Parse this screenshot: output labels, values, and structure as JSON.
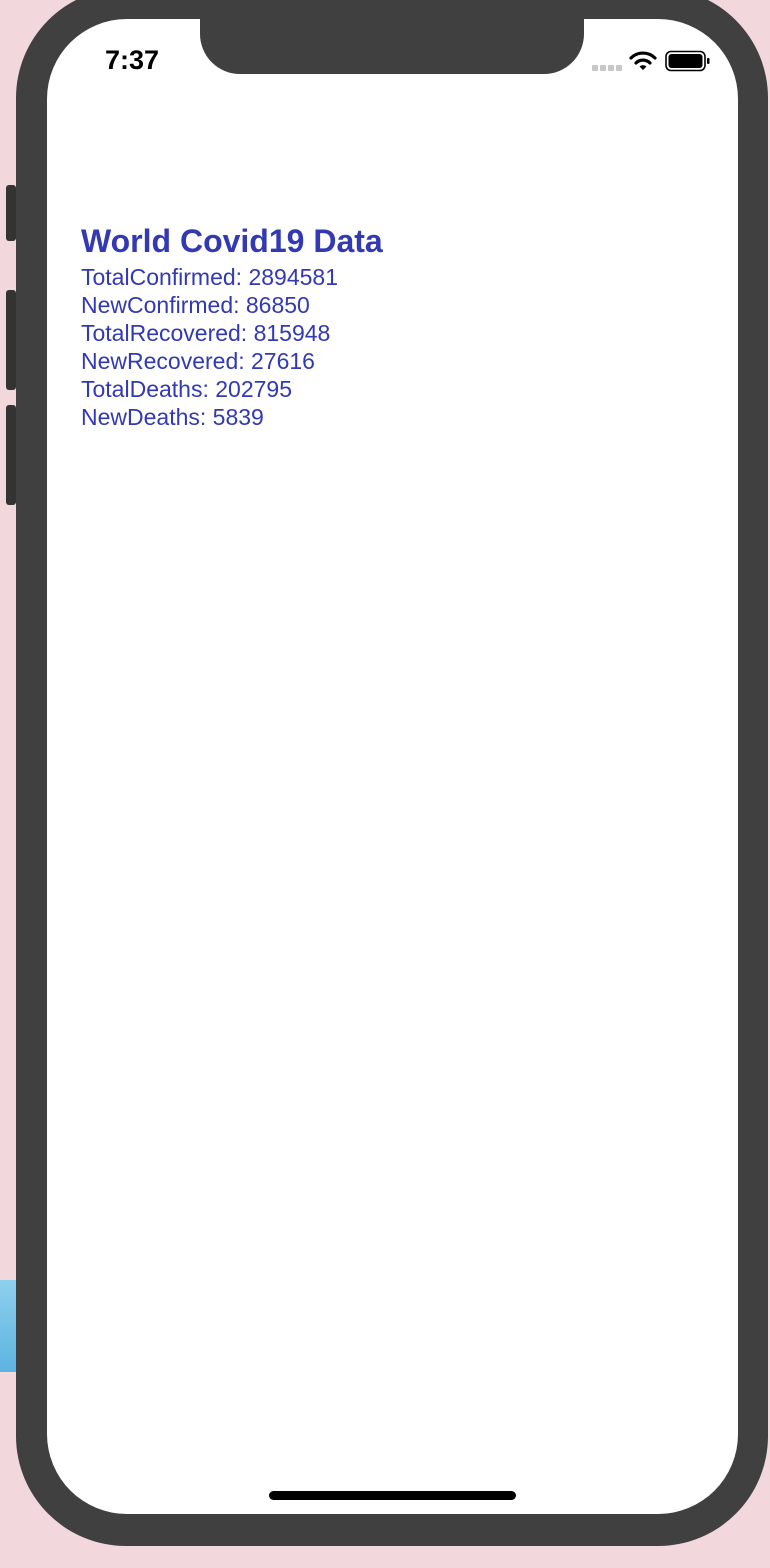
{
  "status_bar": {
    "time": "7:37",
    "signal_icon": "signal-dots-icon",
    "wifi_icon": "wifi-icon",
    "battery_icon": "battery-icon"
  },
  "main": {
    "title": "World Covid19 Data",
    "stats": [
      "TotalConfirmed: 2894581",
      "NewConfirmed: 86850",
      "TotalRecovered: 815948",
      "NewRecovered: 27616",
      "TotalDeaths: 202795",
      "NewDeaths: 5839"
    ]
  },
  "colors": {
    "accent": "#3239b3",
    "background": "#ffffff",
    "device_frame": "#404040",
    "desktop": "#f2d7dd"
  }
}
